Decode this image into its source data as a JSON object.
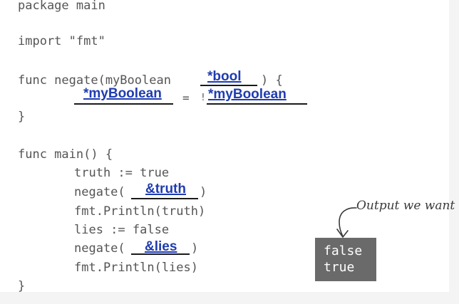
{
  "code": {
    "line_package": "package main",
    "line_import": "import \"fmt\"",
    "func_negate_prefix": "func negate(myBoolean ",
    "func_negate_suffix": ") {",
    "assign_op": "=",
    "not_op": "!",
    "close_brace_1": "}",
    "func_main": "func main() {",
    "line_truth": "truth := true",
    "negate_call_prefix": "negate(",
    "negate_call_suffix": ")",
    "println_truth": "fmt.Println(truth)",
    "line_lies": "lies := false",
    "println_lies": "fmt.Println(lies)",
    "close_brace_2": "}"
  },
  "answers": {
    "param_type": "*bool",
    "lhs": "*myBoolean",
    "rhs": "*myBoolean",
    "arg_truth": "&truth",
    "arg_lies": "&lies"
  },
  "output": {
    "annotation": "Output we want",
    "lines": [
      "false",
      "true"
    ]
  }
}
